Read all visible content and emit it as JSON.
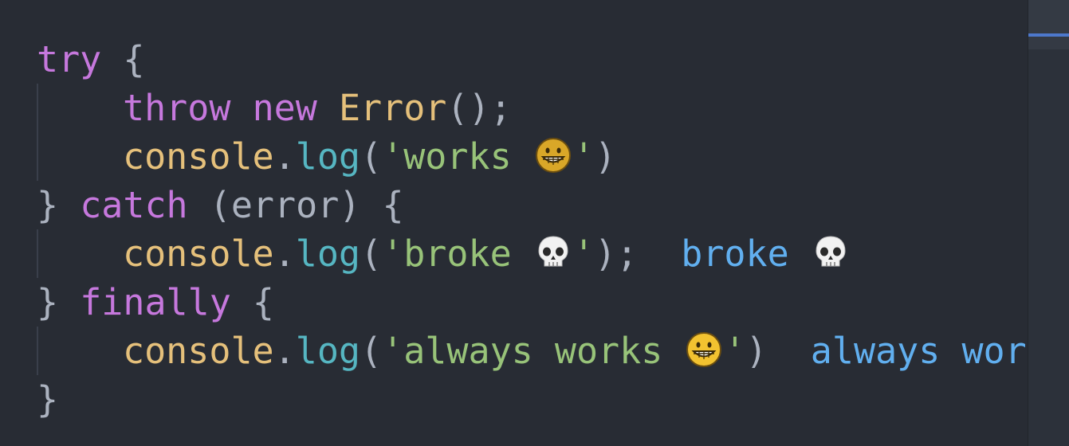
{
  "code": {
    "line1": {
      "kw": "try",
      "brace": " {"
    },
    "line2": {
      "throw": "throw",
      "new": "new",
      "cls": "Error",
      "punc": "();"
    },
    "line3": {
      "obj": "console",
      "dot": ".",
      "fn": "log",
      "open": "(",
      "str": "'works ",
      "close_str": "'",
      "close": ")"
    },
    "line4": {
      "brace": "}",
      "kw": "catch",
      "punc": " (error) {"
    },
    "line5": {
      "obj": "console",
      "dot": ".",
      "fn": "log",
      "open": "(",
      "str": "'broke ",
      "close_str": "'",
      "close": ");",
      "output": "broke"
    },
    "line6": {
      "brace": "}",
      "kw": "finally",
      "punc": " {"
    },
    "line7": {
      "obj": "console",
      "dot": ".",
      "fn": "log",
      "open": "(",
      "str": "'always works ",
      "close_str": "'",
      "close": ")",
      "output": "always works"
    },
    "line8": {
      "brace": "}"
    }
  },
  "icons": {
    "grin": "grinning-face-icon",
    "skull": "skull-icon"
  },
  "colors": {
    "background": "#282c34",
    "keyword": "#c678dd",
    "class": "#e5c07b",
    "function": "#56b6c2",
    "string": "#98c379",
    "inline_output": "#61afef"
  }
}
